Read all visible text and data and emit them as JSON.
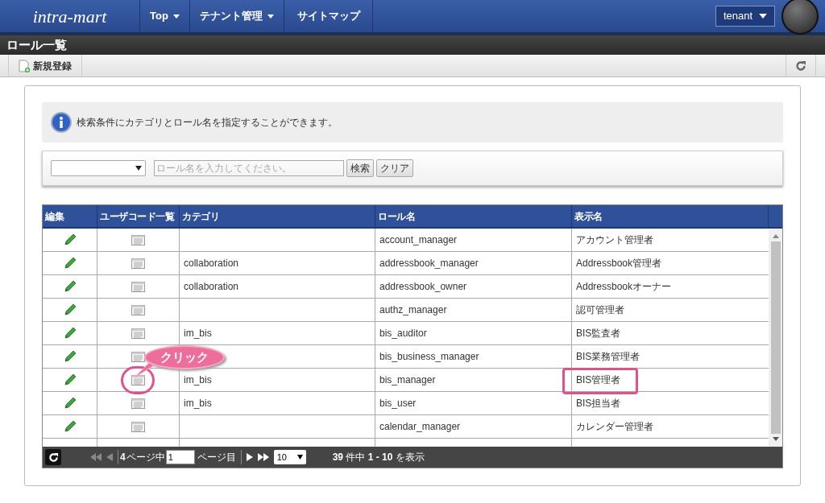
{
  "header": {
    "logo": "intra-mart",
    "menu": [
      {
        "label": "Top",
        "dropdown": true
      },
      {
        "label": "テナント管理",
        "dropdown": true
      },
      {
        "label": "サイトマップ",
        "dropdown": false
      }
    ],
    "tenant": "tenant"
  },
  "title": "ロール一覧",
  "toolbar": {
    "new_button": "新規登録"
  },
  "info": "検索条件にカテゴリとロール名を指定することができます。",
  "search": {
    "placeholder": "ロール名を入力してください。",
    "buttons": [
      "検索",
      "クリア"
    ]
  },
  "table": {
    "columns": [
      "編集",
      "ユーザコード一覧",
      "カテゴリ",
      "ロール名",
      "表示名"
    ],
    "rows": [
      {
        "category": "",
        "role": "account_manager",
        "display": "アカウント管理者",
        "circled": false,
        "boxed": false
      },
      {
        "category": "collaboration",
        "role": "addressbook_manager",
        "display": "Addressbook管理者",
        "circled": false,
        "boxed": false
      },
      {
        "category": "collaboration",
        "role": "addressbook_owner",
        "display": "Addressbookオーナー",
        "circled": false,
        "boxed": false
      },
      {
        "category": "",
        "role": "authz_manager",
        "display": "認可管理者",
        "circled": false,
        "boxed": false
      },
      {
        "category": "im_bis",
        "role": "bis_auditor",
        "display": "BIS監査者",
        "circled": false,
        "boxed": false
      },
      {
        "category": "",
        "role": "bis_business_manager",
        "display": "BIS業務管理者",
        "circled": false,
        "boxed": false
      },
      {
        "category": "im_bis",
        "role": "bis_manager",
        "display": "BIS管理者",
        "circled": true,
        "boxed": true
      },
      {
        "category": "im_bis",
        "role": "bis_user",
        "display": "BIS担当者",
        "circled": false,
        "boxed": false
      },
      {
        "category": "",
        "role": "calendar_manager",
        "display": "カレンダー管理者",
        "circled": false,
        "boxed": false
      }
    ]
  },
  "pager": {
    "total_pages": "4",
    "pages_label": "ページ中",
    "page": "1",
    "page_label": "ページ目",
    "per_page": "10",
    "summary": "**39** 件中 **1 - 10** を表示"
  },
  "callout": "クリック"
}
